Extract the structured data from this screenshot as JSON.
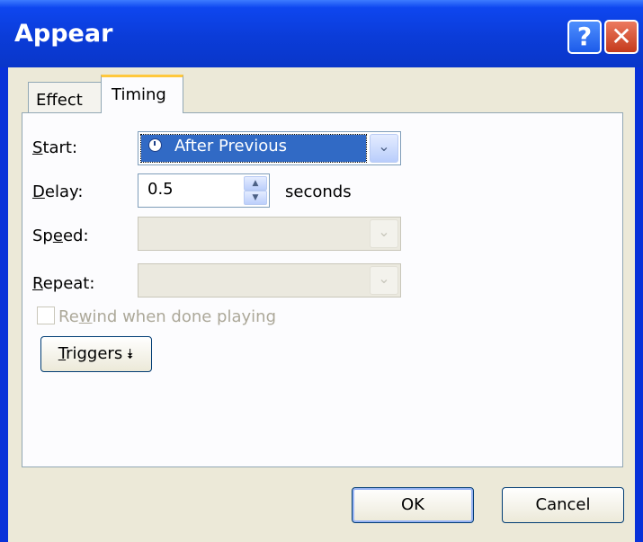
{
  "window": {
    "title": "Appear",
    "help_button": "?",
    "close_button": "✕"
  },
  "tabs": [
    {
      "label": "Effect",
      "active": false
    },
    {
      "label": "Timing",
      "active": true
    }
  ],
  "timing": {
    "start_label_first": "S",
    "start_label_rest": "tart:",
    "start_value": "After Previous",
    "delay_label_first": "D",
    "delay_label_rest": "elay:",
    "delay_value": "0.5",
    "delay_unit": "seconds",
    "speed_label_pre": "Sp",
    "speed_label_u": "e",
    "speed_label_post": "ed:",
    "speed_value": "",
    "repeat_label_first": "R",
    "repeat_label_rest": "epeat:",
    "repeat_value": "",
    "rewind_label_pre": "Re",
    "rewind_label_u": "w",
    "rewind_label_post": "ind when done playing",
    "rewind_checked": false,
    "triggers_label_first": "T",
    "triggers_label_rest": "riggers",
    "triggers_icon": "double-chevron-down-icon"
  },
  "buttons": {
    "ok": "OK",
    "cancel": "Cancel"
  },
  "colors": {
    "titlebar": "#0a3ee6",
    "dialog_bg": "#ece9d8",
    "selection": "#316ac5",
    "active_tab_accent": "#ffc83c"
  }
}
